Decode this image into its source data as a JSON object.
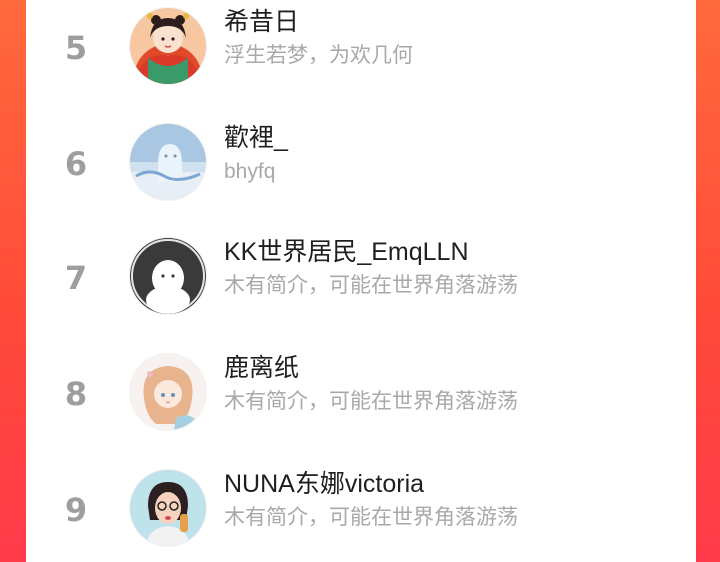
{
  "ranking": {
    "items": [
      {
        "rank": "5",
        "name": "希昔日",
        "bio": "浮生若梦，为欢几何",
        "avatar": "costume-girl-avatar"
      },
      {
        "rank": "6",
        "name": "歡裡_",
        "bio": "bhyfq",
        "avatar": "blue-sky-photo-avatar"
      },
      {
        "rank": "7",
        "name": "KK世界居民_EmqLLN",
        "bio": "木有简介，可能在世界角落游荡",
        "avatar": "default-user-avatar"
      },
      {
        "rank": "8",
        "name": "鹿离纸",
        "bio": "木有简介，可能在世界角落游荡",
        "avatar": "anime-girl-avatar"
      },
      {
        "rank": "9",
        "name": "NUNA东娜victoria",
        "bio": "木有简介，可能在世界角落游荡",
        "avatar": "selfie-woman-avatar"
      }
    ]
  },
  "colors": {
    "background_gradient": [
      "#ff6a3d",
      "#ff3a4a"
    ],
    "card": "#ffffff",
    "rank_number": "#9e9e9e",
    "name_text": "#1f1f1f",
    "bio_text": "#a9a9a9"
  }
}
